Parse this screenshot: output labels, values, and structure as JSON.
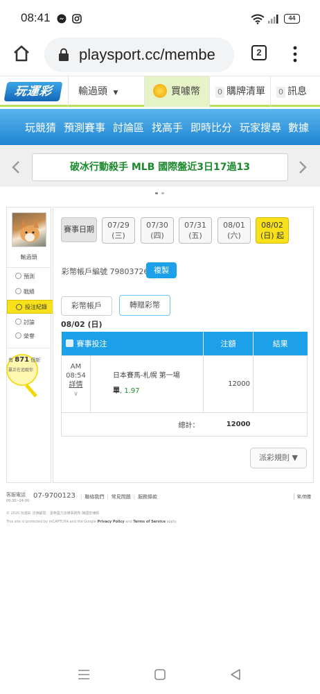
{
  "status_bar": {
    "time": "08:41",
    "battery": "44"
  },
  "browser": {
    "url": "playsport.cc/membe",
    "tab_count": "2"
  },
  "site_header": {
    "logo": "玩運彩",
    "user_menu": "輸過頭",
    "buy_coins": "買噱幣",
    "cart_count": "0",
    "cart_label": "購牌清單",
    "msg_count": "0",
    "msg_label": "訊息"
  },
  "main_nav": [
    "玩競猜",
    "預測賽事",
    "討論區",
    "找高手",
    "即時比分",
    "玩家搜尋",
    "數據"
  ],
  "marquee": {
    "text": "破冰行動殺手 MLB 國際盤近3日17過13"
  },
  "sidebar": {
    "username": "輸過頭",
    "items": [
      "預測",
      "戰績",
      "投注紀錄",
      "討論",
      "榮譽"
    ],
    "bulb_prefix": "有",
    "bulb_count": "871",
    "bulb_unit": "個新",
    "bulb_line2": "贏正在追蹤你"
  },
  "panel": {
    "date_label": "賽事日期",
    "dates": [
      {
        "date": "07/29",
        "day": "(三)"
      },
      {
        "date": "07/30",
        "day": "(四)"
      },
      {
        "date": "07/31",
        "day": "(五)"
      },
      {
        "date": "08/01",
        "day": "(六)"
      },
      {
        "date": "08/02",
        "day": "(日) 起"
      }
    ],
    "account_label": "彩幣帳戶編號 79803726",
    "copy_btn": "複製",
    "tab_account": "彩幣帳戶",
    "tab_transfer": "轉贈彩幣",
    "current_date": "08/02 (日)",
    "table": {
      "col_event": "賽事投注",
      "col_amount": "注額",
      "col_result": "結果",
      "row": {
        "ampm": "AM",
        "time": "08:54",
        "detail": "詳情",
        "event": "日本賽馬-札幌 第一場",
        "bet_type": "單",
        "odds": "1.97",
        "amount": "12000",
        "result": ""
      },
      "total_label": "總計：",
      "total_amount": "12000"
    },
    "rules_btn": "派彩規則 ▼"
  },
  "footer": {
    "service_label": "客服電話",
    "service_hours": "09:30~24:00",
    "phone": "07-9700123",
    "links": [
      "聯絡我們",
      "常見問題",
      "服務條款"
    ],
    "right_link": "繁/簡體",
    "copyright": "© 2020 玩運彩 法律顧問：漢英國力法律事務所 陳國宏律師",
    "recaptcha": "This site is protected by reCAPTCHA and the Google",
    "privacy": "Privacy Policy",
    "and": "and",
    "terms": "Terms of Service",
    "apply": "apply."
  },
  "colors": {
    "accent_blue": "#1ba0e9",
    "nav_blue": "#2f95dc",
    "active_yellow": "#f7e11a",
    "header_green": "#b9dc59",
    "odds_green": "#1b8a2c"
  }
}
